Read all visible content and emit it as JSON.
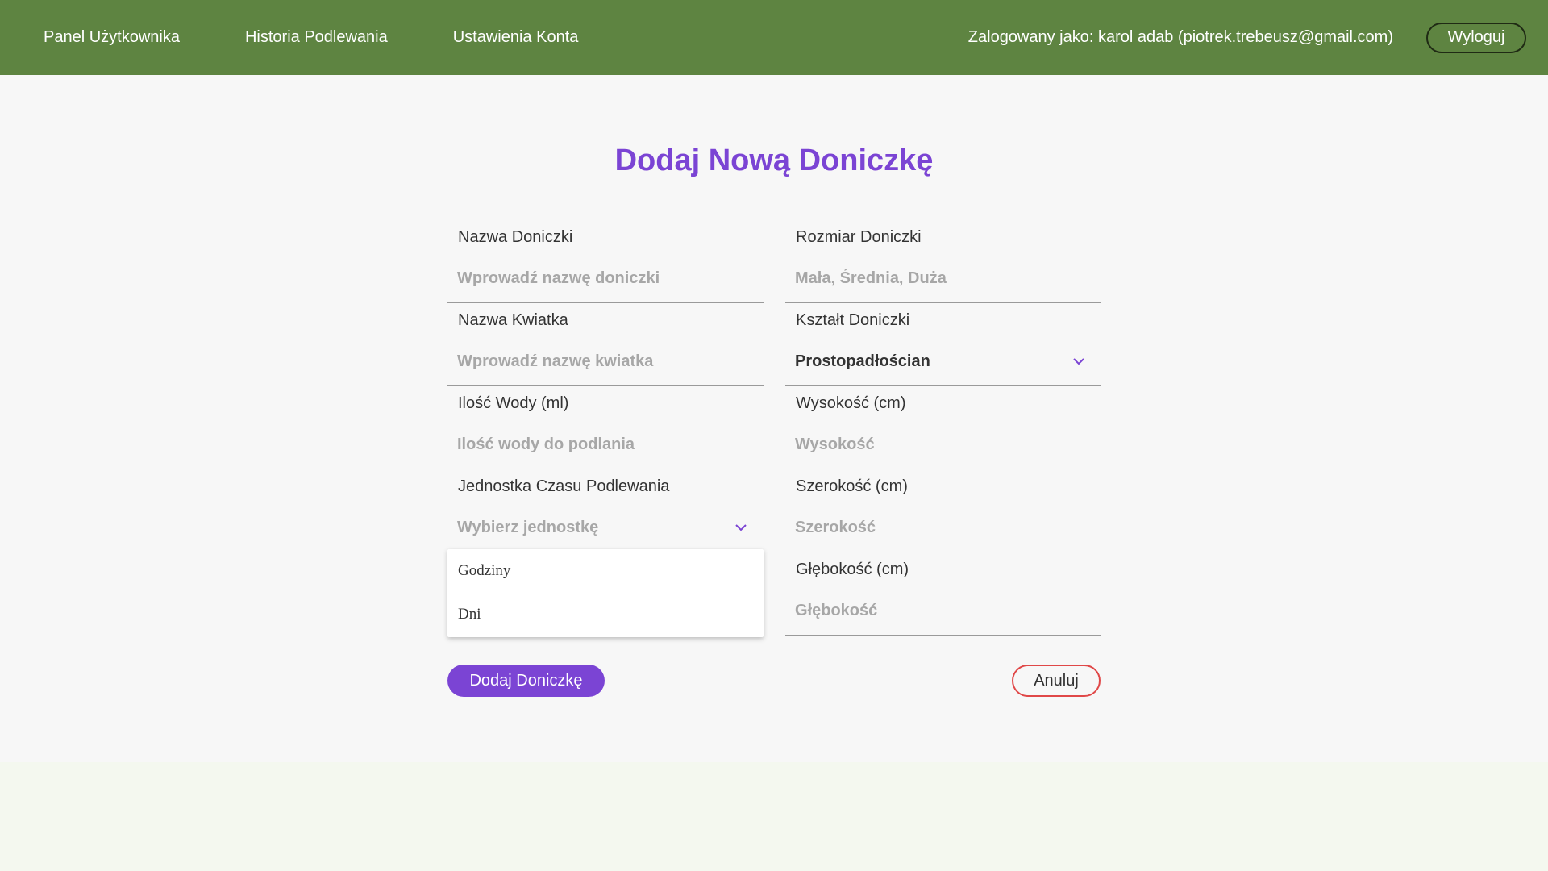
{
  "nav": {
    "items": [
      {
        "label": "Panel Użytkownika"
      },
      {
        "label": "Historia Podlewania"
      },
      {
        "label": "Ustawienia Konta"
      }
    ],
    "user_text": "Zalogowany jako: karol adab (piotrek.trebeusz@gmail.com)",
    "logout_label": "Wyloguj"
  },
  "form": {
    "title": "Dodaj Nową Doniczkę",
    "left": {
      "pot_name": {
        "label": "Nazwa Doniczki",
        "placeholder": "Wprowadź nazwę doniczki",
        "value": ""
      },
      "flower_name": {
        "label": "Nazwa Kwiatka",
        "placeholder": "Wprowadź nazwę kwiatka",
        "value": ""
      },
      "water_amount": {
        "label": "Ilość Wody (ml)",
        "placeholder": "Ilość wody do podlania",
        "value": ""
      },
      "time_unit": {
        "label": "Jednostka Czasu Podlewania",
        "selected": "Wybierz jednostkę"
      }
    },
    "right": {
      "pot_size": {
        "label": "Rozmiar Doniczki",
        "placeholder": "Mała, Średnia, Duża",
        "value": ""
      },
      "pot_shape": {
        "label": "Kształt Doniczki",
        "selected": "Prostopadłościan"
      },
      "height": {
        "label": "Wysokość (cm)",
        "placeholder": "Wysokość",
        "value": ""
      },
      "width": {
        "label": "Szerokość (cm)",
        "placeholder": "Szerokość",
        "value": ""
      },
      "depth": {
        "label": "Głębokość (cm)",
        "placeholder": "Głębokość",
        "value": ""
      }
    },
    "dropdown_options": [
      {
        "label": "Godziny"
      },
      {
        "label": "Dni"
      }
    ],
    "submit_label": "Dodaj Doniczkę",
    "cancel_label": "Anuluj"
  },
  "colors": {
    "header_bg": "#5e8441",
    "accent": "#7b44d4",
    "cancel_border": "#e04848"
  },
  "icons": {
    "select_arrow": "chevron-down-icon"
  }
}
